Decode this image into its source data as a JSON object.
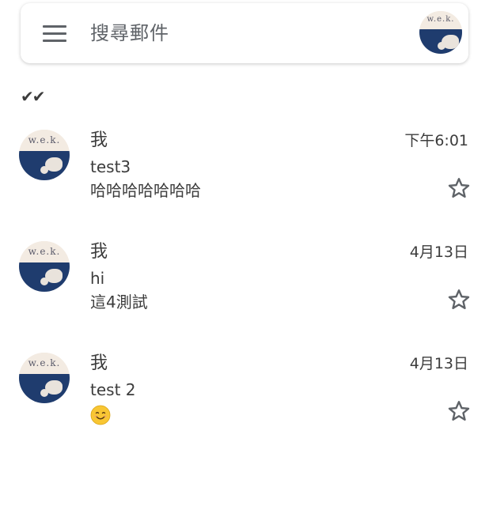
{
  "search": {
    "placeholder": "搜尋郵件",
    "menu_icon": "menu-icon",
    "account_avatar_text": "w.e.k."
  },
  "section": {
    "label": "✔✔"
  },
  "colors": {
    "text": "#3c3c3c",
    "icon": "#5f6368",
    "avatar_navy": "#1f3c6e",
    "avatar_cream": "#f3ebe2",
    "emoji_yellow": "#f8c633"
  },
  "mails": [
    {
      "sender": "我",
      "date": "下午6:01",
      "subject": "test3",
      "snippet": "哈哈哈哈哈哈哈",
      "avatar_text": "w.e.k.",
      "starred": false
    },
    {
      "sender": "我",
      "date": "4月13日",
      "subject": "hi",
      "snippet": "這4測試",
      "avatar_text": "w.e.k.",
      "starred": false
    },
    {
      "sender": "我",
      "date": "4月13日",
      "subject": "test 2",
      "snippet": "",
      "snippet_icon": "smiling-face-emoji-icon",
      "avatar_text": "w.e.k.",
      "starred": false
    }
  ]
}
